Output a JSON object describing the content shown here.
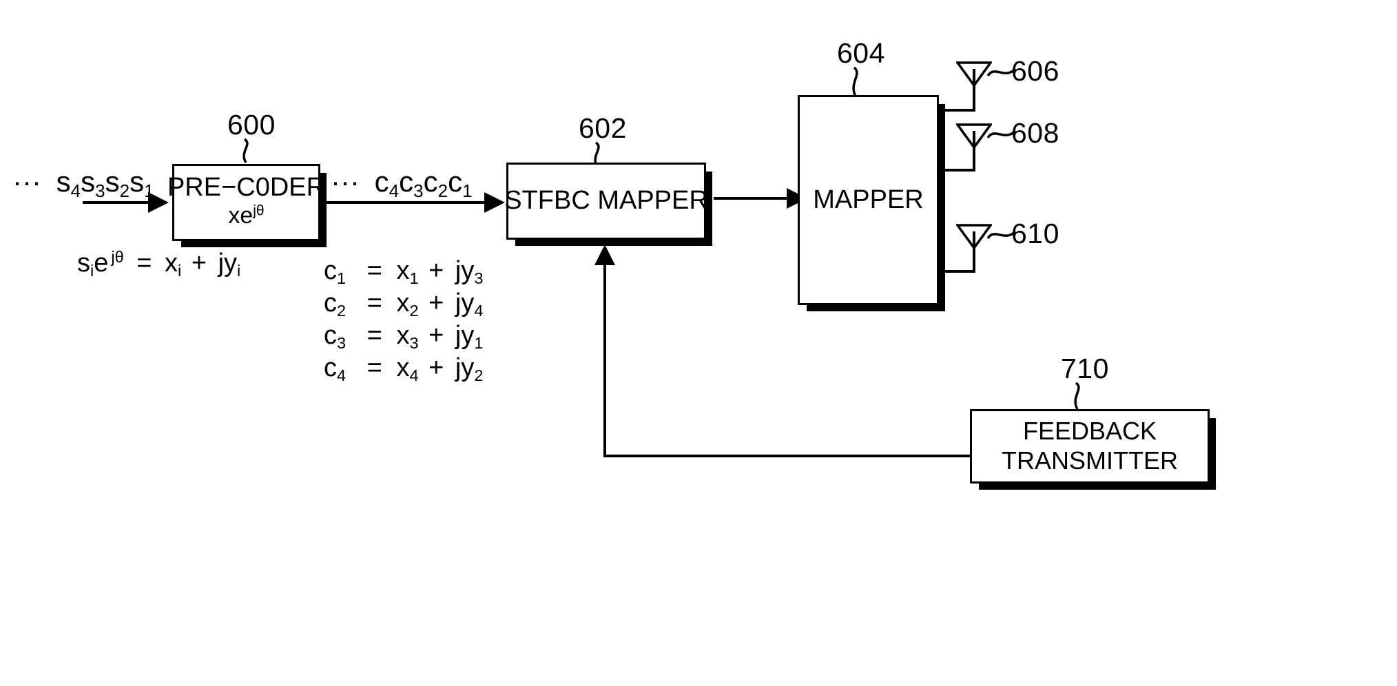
{
  "figure": {
    "type": "patent-block-diagram",
    "background_color": "#ffffff",
    "line_color": "#000000"
  },
  "blocks": [
    {
      "id": "pre-coder",
      "ref": "600",
      "line1": "PRE−C0DER",
      "line2_base": "xe",
      "line2_sup": "jθ"
    },
    {
      "id": "stfbc-mapper",
      "ref": "602",
      "label": "STFBC MAPPER"
    },
    {
      "id": "mapper",
      "ref": "604",
      "label": "MAPPER"
    },
    {
      "id": "feedback-transmitter",
      "ref": "710",
      "line1": "FEEDBACK",
      "line2": "TRANSMITTER"
    }
  ],
  "antennas": [
    {
      "id": "antenna-606",
      "ref": "606"
    },
    {
      "id": "antenna-608",
      "ref": "608"
    },
    {
      "id": "antenna-610",
      "ref": "610"
    }
  ],
  "signals": {
    "input_stream_prefix": "···",
    "input_stream": "s4s3s2s1",
    "input_tokens": [
      {
        "base": "s",
        "sub": "4"
      },
      {
        "base": "s",
        "sub": "3"
      },
      {
        "base": "s",
        "sub": "2"
      },
      {
        "base": "s",
        "sub": "1"
      }
    ],
    "mid_stream_prefix": "···",
    "mid_stream": "c4c3c2c1",
    "mid_tokens": [
      {
        "base": "c",
        "sub": "4"
      },
      {
        "base": "c",
        "sub": "3"
      },
      {
        "base": "c",
        "sub": "2"
      },
      {
        "base": "c",
        "sub": "1"
      }
    ]
  },
  "equations": {
    "precoder_relation": {
      "lhs_base": "s",
      "lhs_sub": "i",
      "lhs_e": "e",
      "lhs_sup": "jθ",
      "eq": "=",
      "rhs_x_base": "x",
      "rhs_x_sub": "i",
      "plus": "+",
      "rhs_jy_base": "jy",
      "rhs_jy_sub": "i",
      "plain": "sᵢe^jθ = xᵢ + jyᵢ"
    },
    "c_list": [
      {
        "lhs": "c",
        "lhs_sub": "1",
        "eq": "=",
        "x": "x",
        "x_sub": "1",
        "plus": "+",
        "jy": "jy",
        "jy_sub": "3",
        "plain": "c1 = x1 + jy3"
      },
      {
        "lhs": "c",
        "lhs_sub": "2",
        "eq": "=",
        "x": "x",
        "x_sub": "2",
        "plus": "+",
        "jy": "jy",
        "jy_sub": "4",
        "plain": "c2 = x2 + jy4"
      },
      {
        "lhs": "c",
        "lhs_sub": "3",
        "eq": "=",
        "x": "x",
        "x_sub": "3",
        "plus": "+",
        "jy": "jy",
        "jy_sub": "1",
        "plain": "c3 = x3 + jy1"
      },
      {
        "lhs": "c",
        "lhs_sub": "4",
        "eq": "=",
        "x": "x",
        "x_sub": "4",
        "plus": "+",
        "jy": "jy",
        "jy_sub": "2",
        "plain": "c4 = x4 + jy2"
      }
    ]
  }
}
